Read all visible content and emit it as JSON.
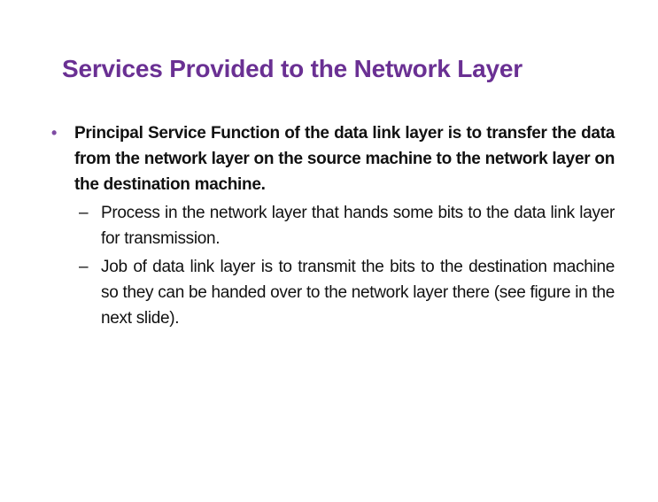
{
  "slide": {
    "title": "Services Provided to the Network Layer",
    "colors": {
      "title": "#6a3093",
      "bullet": "#7e4ba3",
      "text": "#111111"
    },
    "bullets": [
      {
        "marker": "•",
        "text": "Principal Service Function of the data link layer is to transfer the data from the network layer on the source machine to the network layer on the destination machine.",
        "sub_items": [
          {
            "marker": "–",
            "text": "Process in the network layer that hands some bits to the data link layer for transmission."
          },
          {
            "marker": "–",
            "text": "Job of data link layer is to transmit the bits to the destination machine so they can be handed over to the network layer there (see figure in the next slide)."
          }
        ]
      }
    ]
  }
}
